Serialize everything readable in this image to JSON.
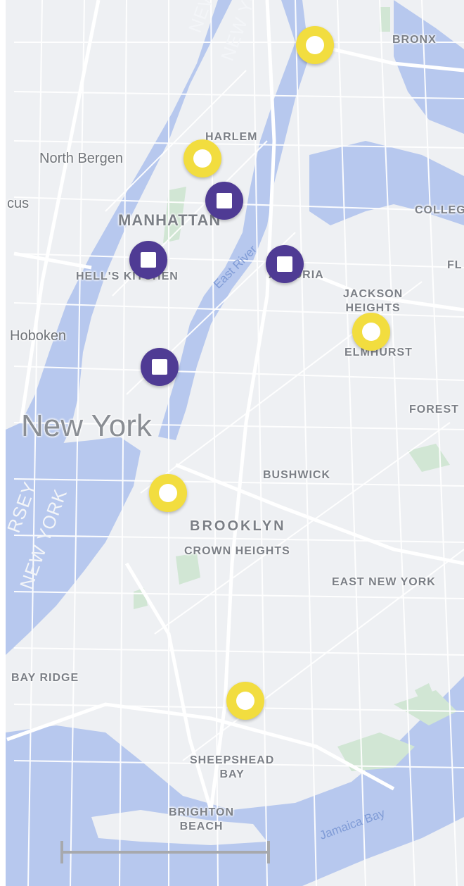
{
  "map": {
    "colors": {
      "water": "#b7c8ee",
      "land": "#eef0f3",
      "road": "#ffffff",
      "park": "#d1e6d4",
      "label": "#7b7f86",
      "marker_yellow": "#f2dd3f",
      "marker_purple": "#4f3b94"
    },
    "labels": {
      "bronx": "BRONX",
      "harlem": "HARLEM",
      "north_bergen": "North Bergen",
      "cus": "cus",
      "manhattan": "MANHATTAN",
      "colleg": "COLLEG",
      "fl": "FL",
      "hells_kitchen": "HELL'S KITCHEN",
      "east_river": "East River",
      "astoria": "ASTORIA",
      "jackson_heights": "JACKSON\nHEIGHTS",
      "elmhurst": "ELMHURST",
      "hoboken": "Hoboken",
      "forest": "FOREST",
      "new_york": "New York",
      "bushwick": "BUSHWICK",
      "brooklyn": "BROOKLYN",
      "crown_heights": "CROWN HEIGHTS",
      "east_new_york": "EAST NEW YORK",
      "bay_ridge": "BAY RIDGE",
      "sheepshead_bay": "SHEEPSHEAD\nBAY",
      "brighton_beach": "BRIGHTON\nBEACH",
      "jamaica_bay": "Jamaica Bay",
      "new_jersey": "NEW JE",
      "new_york_state": "NEW YO",
      "jersey": "RSEY",
      "new_york_side": "NEW YORK"
    },
    "markers": [
      {
        "type": "circle",
        "name": "marker-bronx"
      },
      {
        "type": "circle",
        "name": "marker-harlem"
      },
      {
        "type": "square",
        "name": "marker-upper-manhattan"
      },
      {
        "type": "square",
        "name": "marker-hells-kitchen"
      },
      {
        "type": "square",
        "name": "marker-astoria"
      },
      {
        "type": "circle",
        "name": "marker-elmhurst"
      },
      {
        "type": "square",
        "name": "marker-midtown-south"
      },
      {
        "type": "circle",
        "name": "marker-brooklyn-heights"
      },
      {
        "type": "circle",
        "name": "marker-sheepshead"
      }
    ]
  }
}
